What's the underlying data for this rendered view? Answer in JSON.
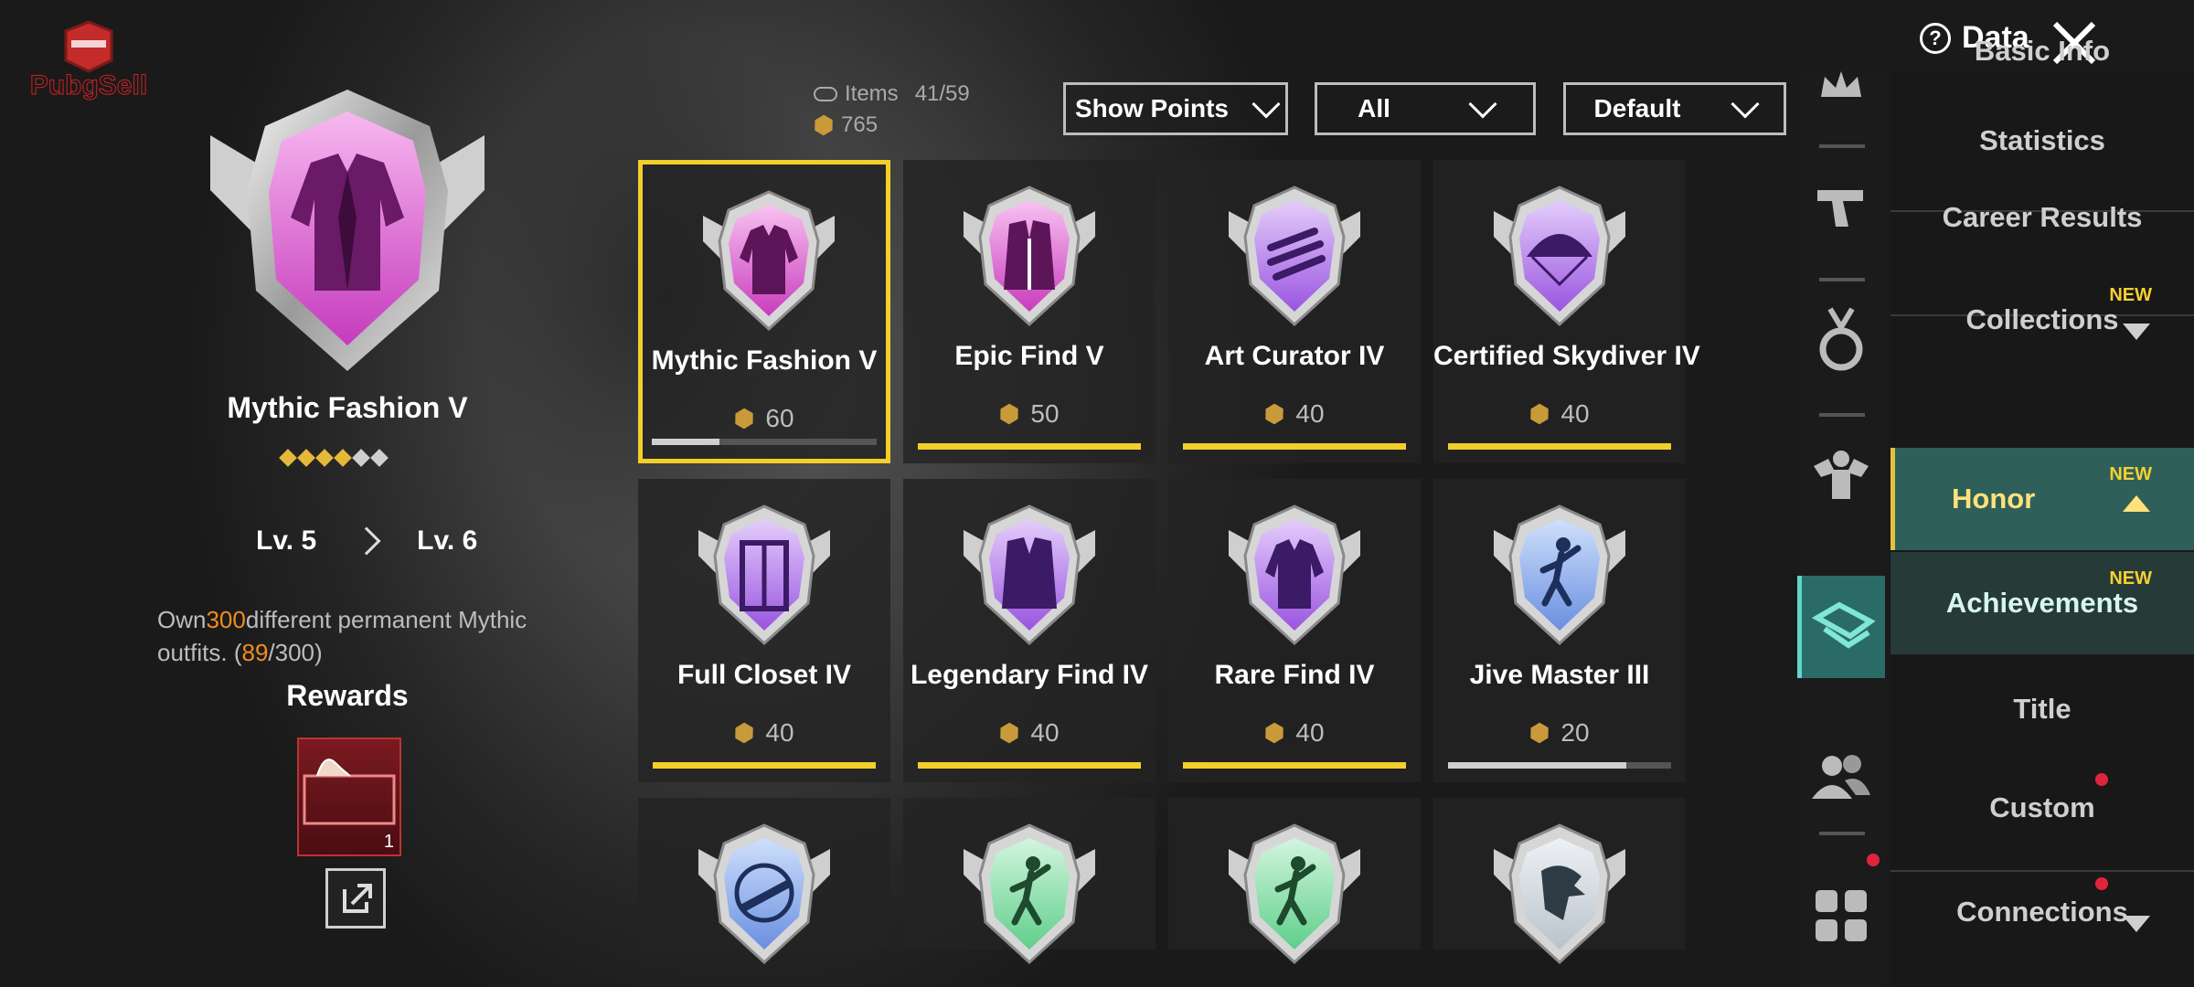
{
  "logo": {
    "text": "PubgSell"
  },
  "header": {
    "data_label": "Data"
  },
  "stats": {
    "items_label": "Items",
    "items_value": "41/59",
    "points": "765"
  },
  "filters": {
    "show_points": "Show Points",
    "category": "All",
    "sort": "Default"
  },
  "selected": {
    "name": "Mythic Fashion V",
    "stars_total": 6,
    "stars_filled": 4,
    "level_from": "Lv. 5",
    "level_to": "Lv. 6",
    "desc_prefix": "Own",
    "desc_count": "300",
    "desc_mid": "different permanent Mythic outfits. (",
    "desc_progress": "89",
    "desc_suffix": "/300)",
    "rewards_label": "Rewards",
    "reward_count": "1"
  },
  "achievements": [
    {
      "name": "Mythic Fashion V",
      "points": "60",
      "progress": 0.3,
      "color": "pink",
      "icon": "jacket-icon"
    },
    {
      "name": "Epic Find V",
      "points": "50",
      "progress": 1,
      "color": "pink",
      "icon": "coat-icon"
    },
    {
      "name": "Art Curator IV",
      "points": "40",
      "progress": 1,
      "color": "purple",
      "icon": "claw-icon"
    },
    {
      "name": "Certified Skydiver IV",
      "points": "40",
      "progress": 1,
      "color": "purple",
      "icon": "parachute-icon"
    },
    {
      "name": "Full Closet IV",
      "points": "40",
      "progress": 1,
      "color": "purple",
      "icon": "wardrobe-icon"
    },
    {
      "name": "Legendary Find IV",
      "points": "40",
      "progress": 1,
      "color": "purple",
      "icon": "robe-icon"
    },
    {
      "name": "Rare Find IV",
      "points": "40",
      "progress": 1,
      "color": "purple",
      "icon": "jacket-icon"
    },
    {
      "name": "Jive Master III",
      "points": "20",
      "progress": 0.8,
      "color": "blue",
      "icon": "dancer-icon"
    },
    {
      "name": "",
      "points": "",
      "progress": null,
      "color": "blue",
      "icon": "rifle-icon"
    },
    {
      "name": "",
      "points": "",
      "progress": null,
      "color": "green",
      "icon": "dancer-icon"
    },
    {
      "name": "",
      "points": "",
      "progress": null,
      "color": "green",
      "icon": "dancer-icon"
    },
    {
      "name": "",
      "points": "",
      "progress": null,
      "color": "grey",
      "icon": "eagle-icon"
    }
  ],
  "menu": {
    "basic_info": "Basic Info",
    "statistics": "Statistics",
    "career_results": "Career Results",
    "collections": "Collections",
    "honor": "Honor",
    "achievements": "Achievements",
    "title": "Title",
    "custom": "Custom",
    "connections": "Connections",
    "new_label": "NEW"
  },
  "icon_column": [
    "crown-icon",
    "pistol-icon",
    "medal-icon",
    "muscle-icon",
    "honor-icon",
    "friends-icon",
    "grid-icon"
  ],
  "colors": {
    "accent": "#f2cf2a",
    "active_teal": "#2b6b66",
    "highlight_orange": "#f28c1e",
    "notification_red": "#e0243c"
  }
}
